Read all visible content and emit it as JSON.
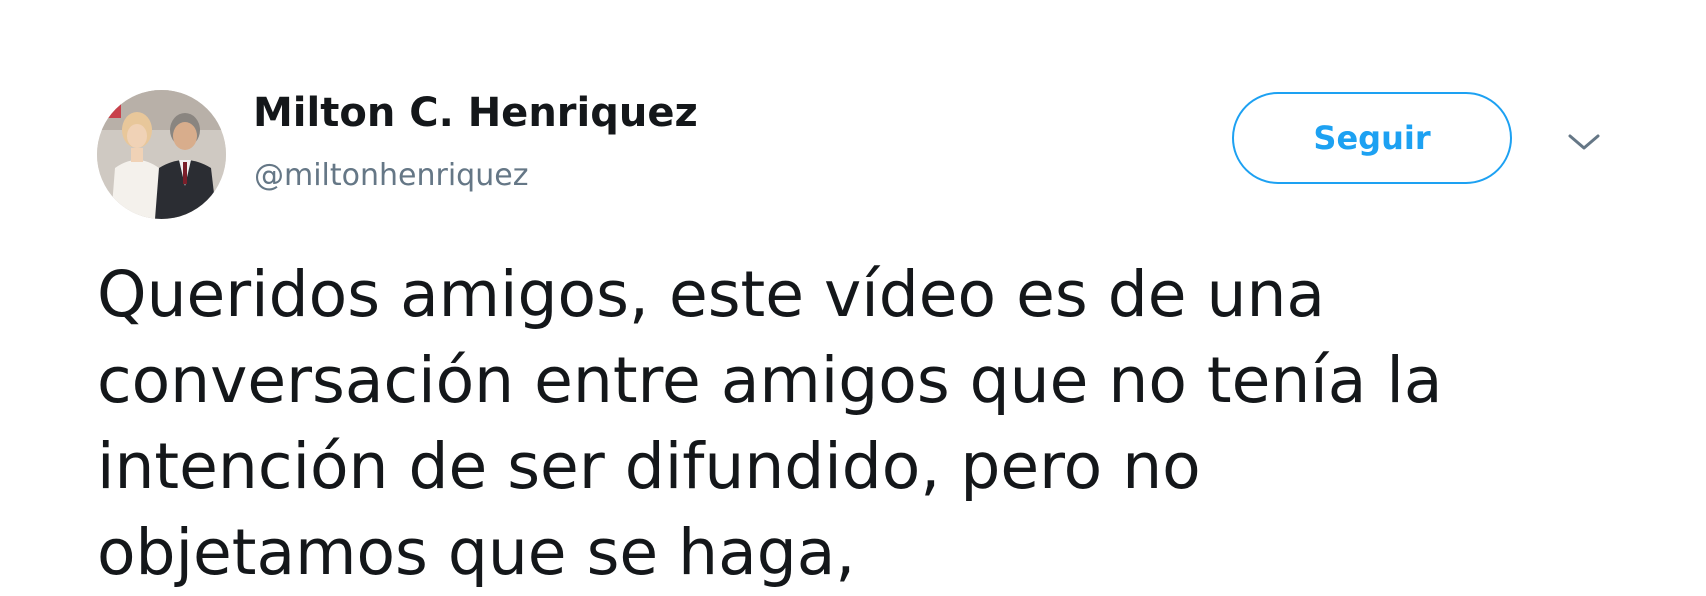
{
  "tweet": {
    "author": {
      "name": "Milton C. Henriquez",
      "handle": "@miltonhenriquez",
      "avatar_icon": "profile-photo-icon"
    },
    "follow_button_label": "Seguir",
    "more_icon": "chevron-down-icon",
    "text_lines": [
      "Queridos amigos, este vídeo es de una",
      "conversación entre amigos que no tenía la",
      "intención de ser difundido, pero no",
      "objetamos que se haga,"
    ]
  },
  "colors": {
    "accent": "#1da1f2",
    "text_primary": "#14171a",
    "text_secondary": "#657786"
  }
}
